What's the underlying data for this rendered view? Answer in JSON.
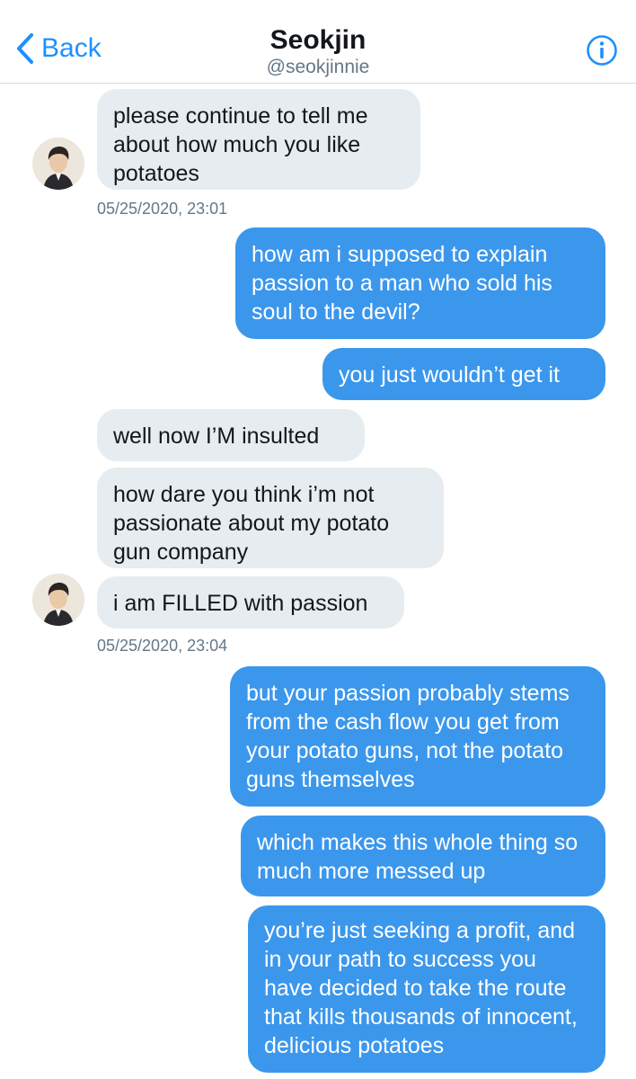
{
  "header": {
    "back_label": "Back",
    "title": "Seokjin",
    "handle": "@seokjinnie"
  },
  "messages": [
    {
      "side": "in",
      "text": "please continue to tell me about how much you like potatoes"
    },
    {
      "timestamp": "05/25/2020, 23:01"
    },
    {
      "side": "out",
      "text": "how am i supposed to explain passion to a man who sold his soul to the devil?"
    },
    {
      "side": "out",
      "text": "you just wouldn’t get it"
    },
    {
      "side": "in",
      "text": "well now I’M insulted"
    },
    {
      "side": "in",
      "text": "how dare you think i’m not passionate about my potato gun company"
    },
    {
      "side": "in",
      "text": "i am FILLED with passion"
    },
    {
      "timestamp": "05/25/2020, 23:04"
    },
    {
      "side": "out",
      "text": "but your passion probably stems from the cash flow you get from your potato guns, not the potato guns themselves"
    },
    {
      "side": "out",
      "text": "which makes this whole thing so much more messed up"
    },
    {
      "side": "out",
      "text": "you’re just seeking a profit, and in your path to success you have decided to take the route that kills thousands of innocent, delicious potatoes"
    }
  ],
  "icons": {
    "back": "chevron-left-icon",
    "info": "info-icon"
  },
  "colors": {
    "accent": "#1e90ff",
    "outgoing_bubble": "#3b97ec",
    "incoming_bubble": "#e6ecf0"
  }
}
